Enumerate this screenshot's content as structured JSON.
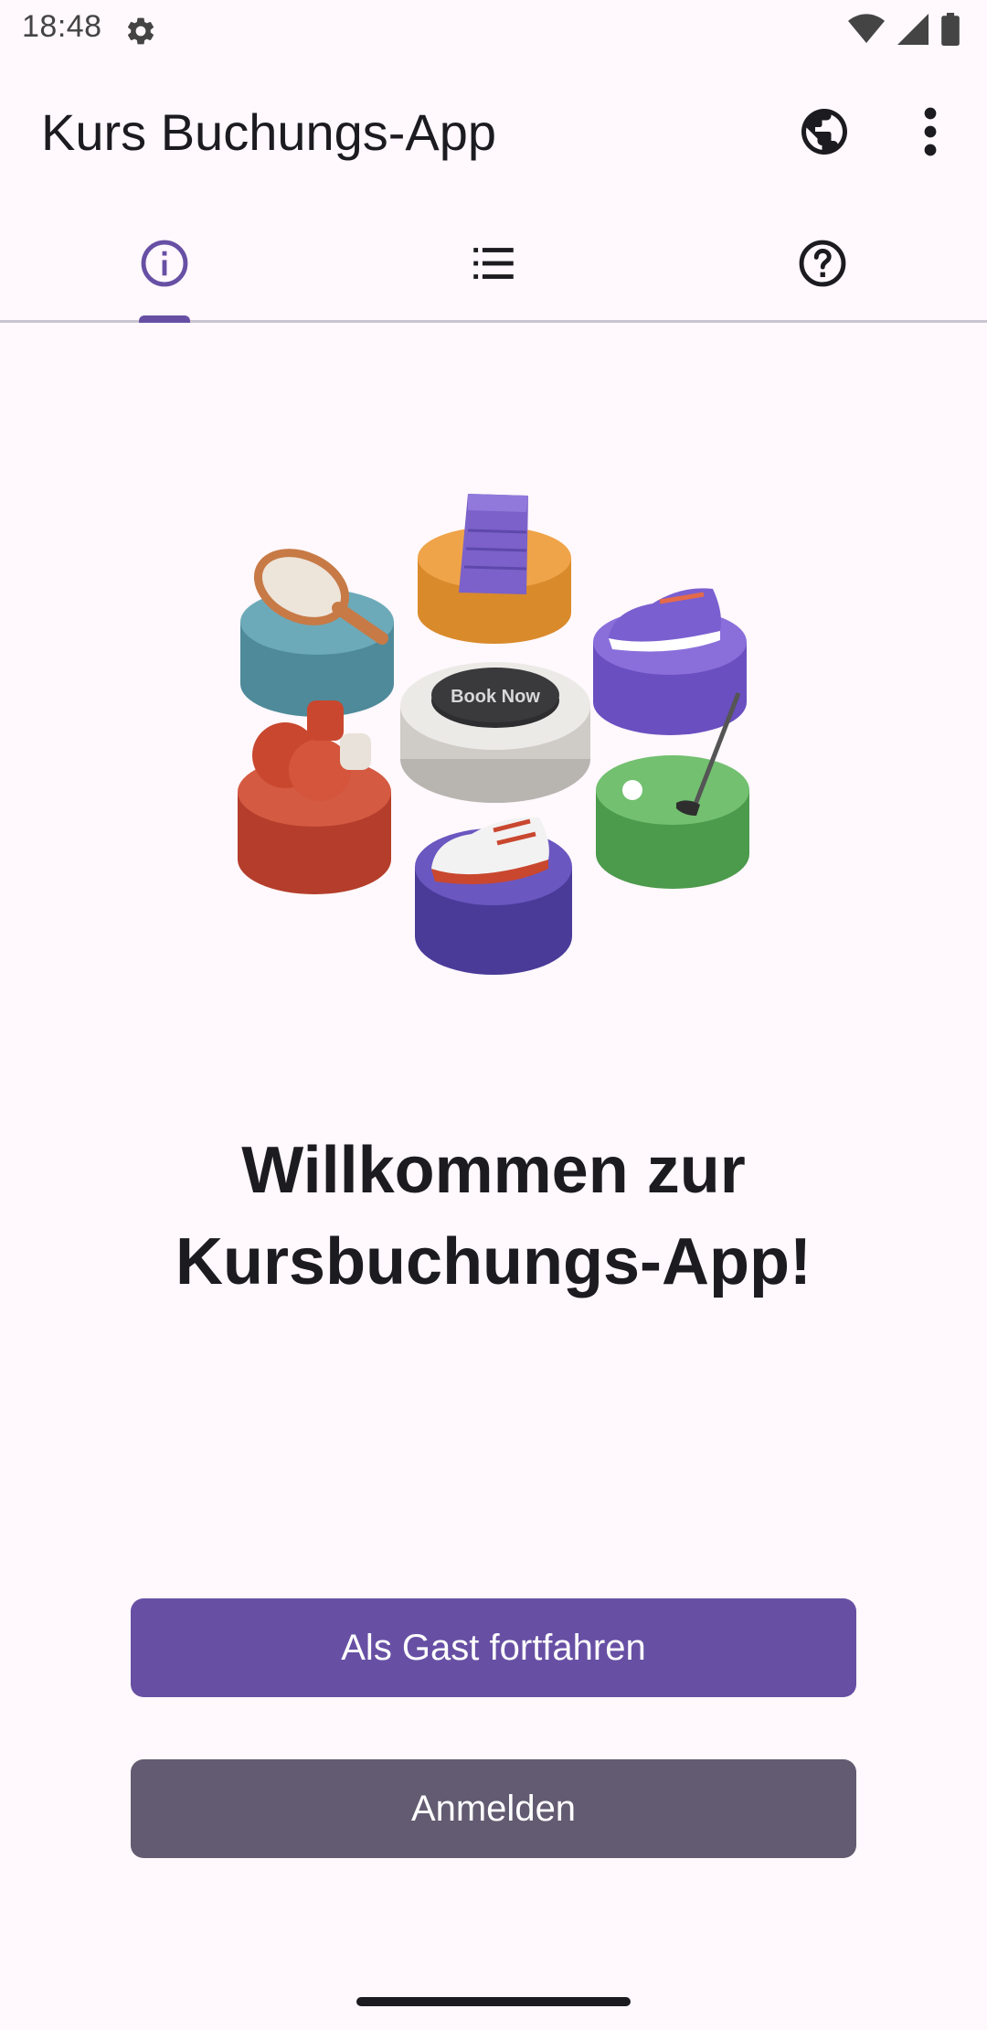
{
  "status_bar": {
    "time": "18:48",
    "icons": [
      "settings-gear-icon",
      "wifi-icon",
      "signal-icon",
      "battery-icon"
    ]
  },
  "app_bar": {
    "title": "Kurs Buchungs-App",
    "actions": [
      "globe-icon",
      "more-vert-icon"
    ]
  },
  "tabs": [
    {
      "icon": "info-icon",
      "selected": true
    },
    {
      "icon": "list-icon",
      "selected": false
    },
    {
      "icon": "help-icon",
      "selected": false
    }
  ],
  "illustration": {
    "center_button_text": "Book Now"
  },
  "welcome": {
    "line1": "Willkommen zur",
    "line2": "Kursbuchungs-App!"
  },
  "buttons": {
    "guest_label": "Als Gast fortfahren",
    "login_label": "Anmelden"
  },
  "colors": {
    "primary": "#6750A4",
    "secondary": "#625B71",
    "background": "#FFF8FC"
  }
}
